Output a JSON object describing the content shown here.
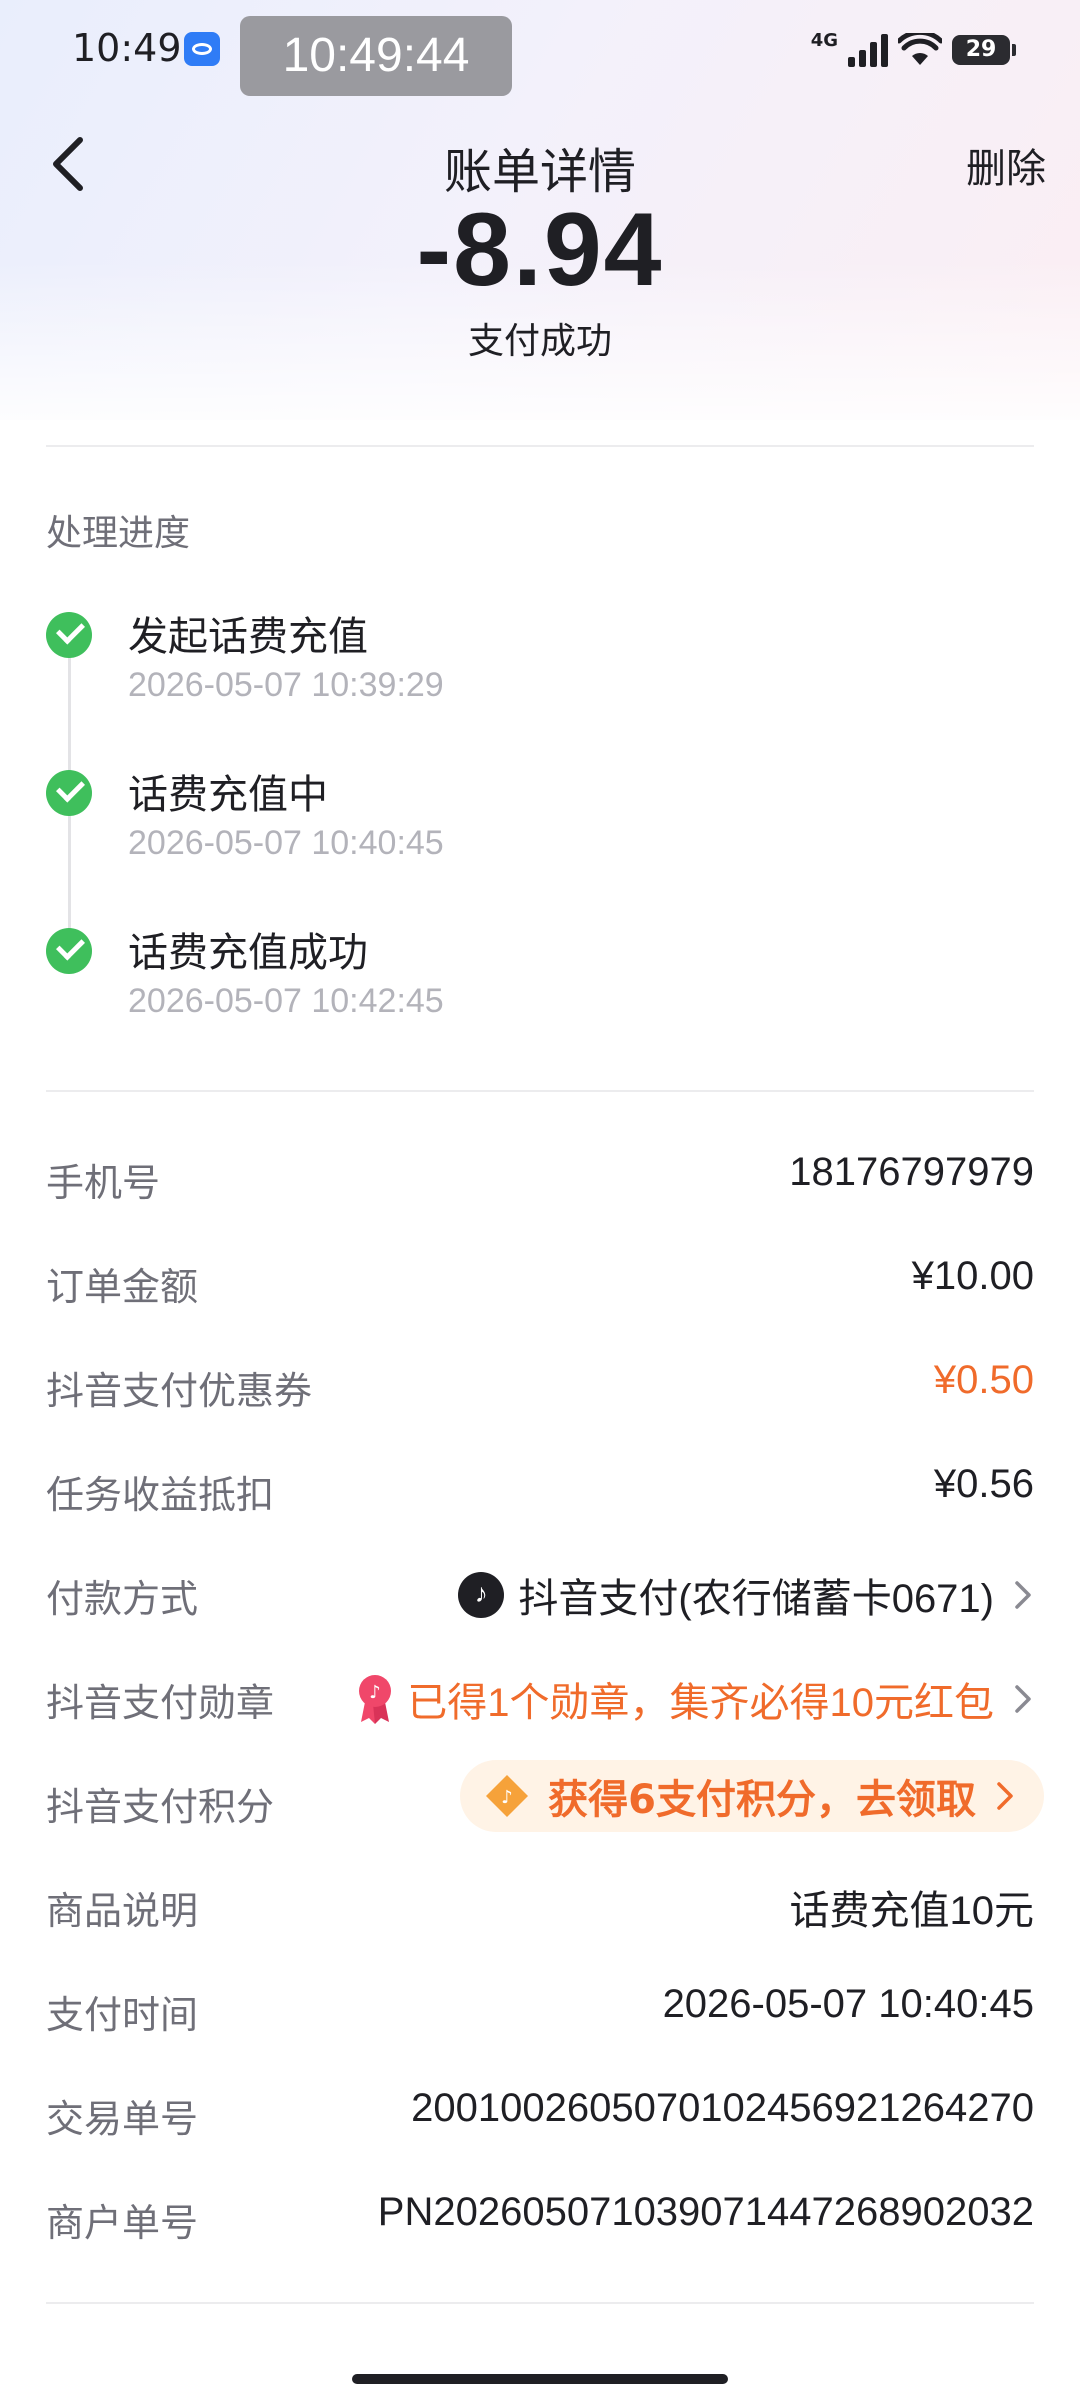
{
  "status_bar": {
    "time": "10:49",
    "overlay_time": "10:49:44",
    "network": "4G",
    "battery": "29"
  },
  "header": {
    "title": "账单详情",
    "delete_label": "删除"
  },
  "summary": {
    "amount": "-8.94",
    "status": "支付成功"
  },
  "progress": {
    "title": "处理进度",
    "steps": [
      {
        "title": "发起话费充值",
        "time": "2026-05-07 10:39:29"
      },
      {
        "title": "话费充值中",
        "time": "2026-05-07 10:40:45"
      },
      {
        "title": "话费充值成功",
        "time": "2026-05-07 10:42:45"
      }
    ]
  },
  "details": {
    "phone": {
      "label": "手机号",
      "value": "18176797979"
    },
    "order_amount": {
      "label": "订单金额",
      "value": "¥10.00"
    },
    "coupon": {
      "label": "抖音支付优惠券",
      "value": "¥0.50"
    },
    "task_deduct": {
      "label": "任务收益抵扣",
      "value": "¥0.56"
    },
    "payment_method": {
      "label": "付款方式",
      "value": "抖音支付(农行储蓄卡0671)"
    },
    "badge": {
      "label": "抖音支付勋章",
      "value": "已得1个勋章，集齐必得10元红包"
    },
    "points": {
      "label": "抖音支付积分",
      "value": "获得6支付积分，去领取"
    },
    "product": {
      "label": "商品说明",
      "value": "话费充值10元"
    },
    "pay_time": {
      "label": "支付时间",
      "value": "2026-05-07 10:40:45"
    },
    "trade_no": {
      "label": "交易单号",
      "value": "2001002605070102456921264270"
    },
    "merchant_no": {
      "label": "商户单号",
      "value": "PN2026050710390714472689020​32"
    }
  },
  "colors": {
    "accent_orange": "#f06b2b",
    "success_green": "#3fbf5c",
    "medal_red": "#f0476a"
  }
}
